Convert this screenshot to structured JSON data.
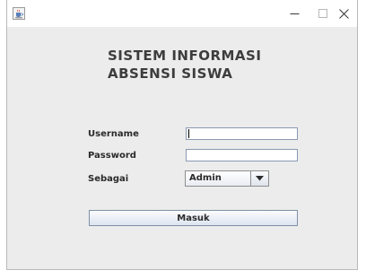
{
  "window": {
    "controls": {
      "minimize": "—",
      "maximize": "☐",
      "close": "✕"
    }
  },
  "heading": {
    "line1": "SISTEM INFORMASI",
    "line2": "ABSENSI SISWA"
  },
  "form": {
    "username_label": "Username",
    "username_value": "",
    "password_label": "Password",
    "password_value": "",
    "role_label": "Sebagai",
    "role_value": "Admin",
    "submit_label": "Masuk"
  },
  "icons": {
    "app": "java-cup-icon",
    "dropdown": "chevron-down-icon"
  },
  "colors": {
    "window_bg": "#ececec",
    "titlebar_bg": "#ffffff",
    "text": "#2a2a2a",
    "field_border": "#8a9ab2"
  }
}
